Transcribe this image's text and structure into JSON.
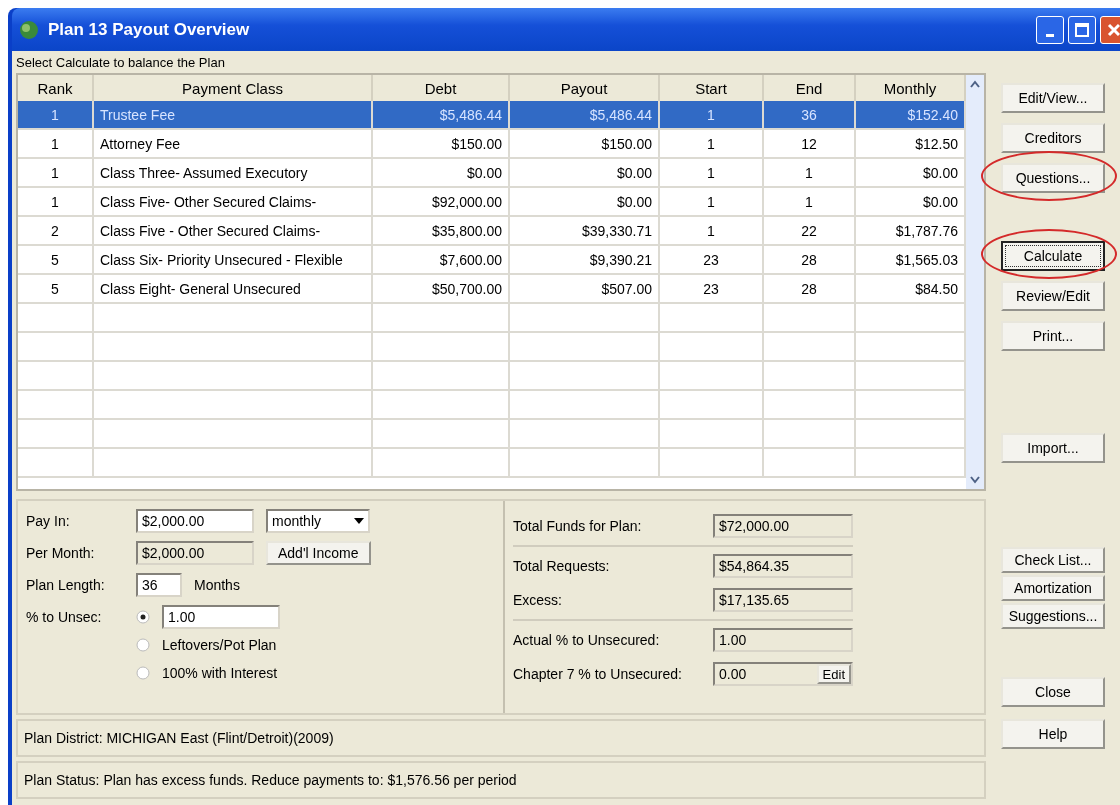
{
  "window": {
    "title": "Plan 13 Payout Overview"
  },
  "instruction": "Select Calculate to balance the Plan",
  "table": {
    "columns": [
      "Rank",
      "Payment Class",
      "Debt",
      "Payout",
      "Start",
      "End",
      "Monthly"
    ],
    "rows": [
      {
        "cells": [
          "1",
          "Trustee Fee",
          "$5,486.44",
          "$5,486.44",
          "1",
          "36",
          "$152.40"
        ],
        "selected": true
      },
      {
        "cells": [
          "1",
          "Attorney Fee",
          "$150.00",
          "$150.00",
          "1",
          "12",
          "$12.50"
        ],
        "selected": false
      },
      {
        "cells": [
          "1",
          "Class Three- Assumed Executory",
          "$0.00",
          "$0.00",
          "1",
          "1",
          "$0.00"
        ],
        "selected": false
      },
      {
        "cells": [
          "1",
          "Class Five- Other Secured Claims-",
          "$92,000.00",
          "$0.00",
          "1",
          "1",
          "$0.00"
        ],
        "selected": false
      },
      {
        "cells": [
          "2",
          "Class Five - Other Secured Claims-",
          "$35,800.00",
          "$39,330.71",
          "1",
          "22",
          "$1,787.76"
        ],
        "selected": false
      },
      {
        "cells": [
          "5",
          "Class Six- Priority Unsecured - Flexible",
          "$7,600.00",
          "$9,390.21",
          "23",
          "28",
          "$1,565.03"
        ],
        "selected": false
      },
      {
        "cells": [
          "5",
          "Class Eight- General Unsecured",
          "$50,700.00",
          "$507.00",
          "23",
          "28",
          "$84.50"
        ],
        "selected": false
      }
    ]
  },
  "pay_in": {
    "label": "Pay In:",
    "value": "$2,000.00",
    "frequency": "monthly"
  },
  "per_month": {
    "label": "Per Month:",
    "value": "$2,000.00",
    "button": "Add'l Income"
  },
  "plan_length": {
    "label": "Plan Length:",
    "value": "36",
    "unit": "Months"
  },
  "unsecured": {
    "label": "% to Unsec:",
    "options": [
      {
        "kind": "input",
        "value": "1.00",
        "selected": true
      },
      {
        "kind": "text",
        "label": "Leftovers/Pot Plan",
        "selected": false
      },
      {
        "kind": "text",
        "label": "100% with Interest",
        "selected": false
      }
    ]
  },
  "total_sections": [
    [
      {
        "label": "Total Funds for Plan:",
        "value": "$72,000.00"
      }
    ],
    [
      {
        "label": "Total Requests:",
        "value": "$54,864.35"
      },
      {
        "label": "Excess:",
        "value": "$17,135.65"
      }
    ],
    [
      {
        "label": "Actual % to Unsecured:",
        "value": "1.00"
      },
      {
        "label": "Chapter 7 % to Unsecured:",
        "value": "0.00",
        "button": "Edit"
      }
    ]
  ],
  "district": "Plan District:  MICHIGAN East (Flint/Detroit)(2009)",
  "status": "Plan Status:  Plan has excess funds.  Reduce payments to: $1,576.56 per period",
  "button_groups": [
    [
      {
        "label": "Edit/View...",
        "highlighted": false,
        "focused": false
      },
      {
        "label": "Creditors",
        "highlighted": false,
        "focused": false
      },
      {
        "label": "Questions...",
        "highlighted": true,
        "focused": false
      }
    ],
    [
      {
        "label": "Calculate",
        "highlighted": true,
        "focused": true
      },
      {
        "label": "Review/Edit",
        "highlighted": false,
        "focused": false
      },
      {
        "label": "Print...",
        "highlighted": false,
        "focused": false
      }
    ],
    [
      {
        "label": "Import...",
        "highlighted": false,
        "focused": false
      }
    ],
    [
      {
        "label": "Check List...",
        "highlighted": false,
        "focused": false
      },
      {
        "label": "Amortization",
        "highlighted": false,
        "focused": false
      },
      {
        "label": "Suggestions...",
        "highlighted": false,
        "focused": false
      }
    ],
    [
      {
        "label": "Close",
        "highlighted": false,
        "focused": false
      },
      {
        "label": "Help",
        "highlighted": false,
        "focused": false
      }
    ]
  ]
}
